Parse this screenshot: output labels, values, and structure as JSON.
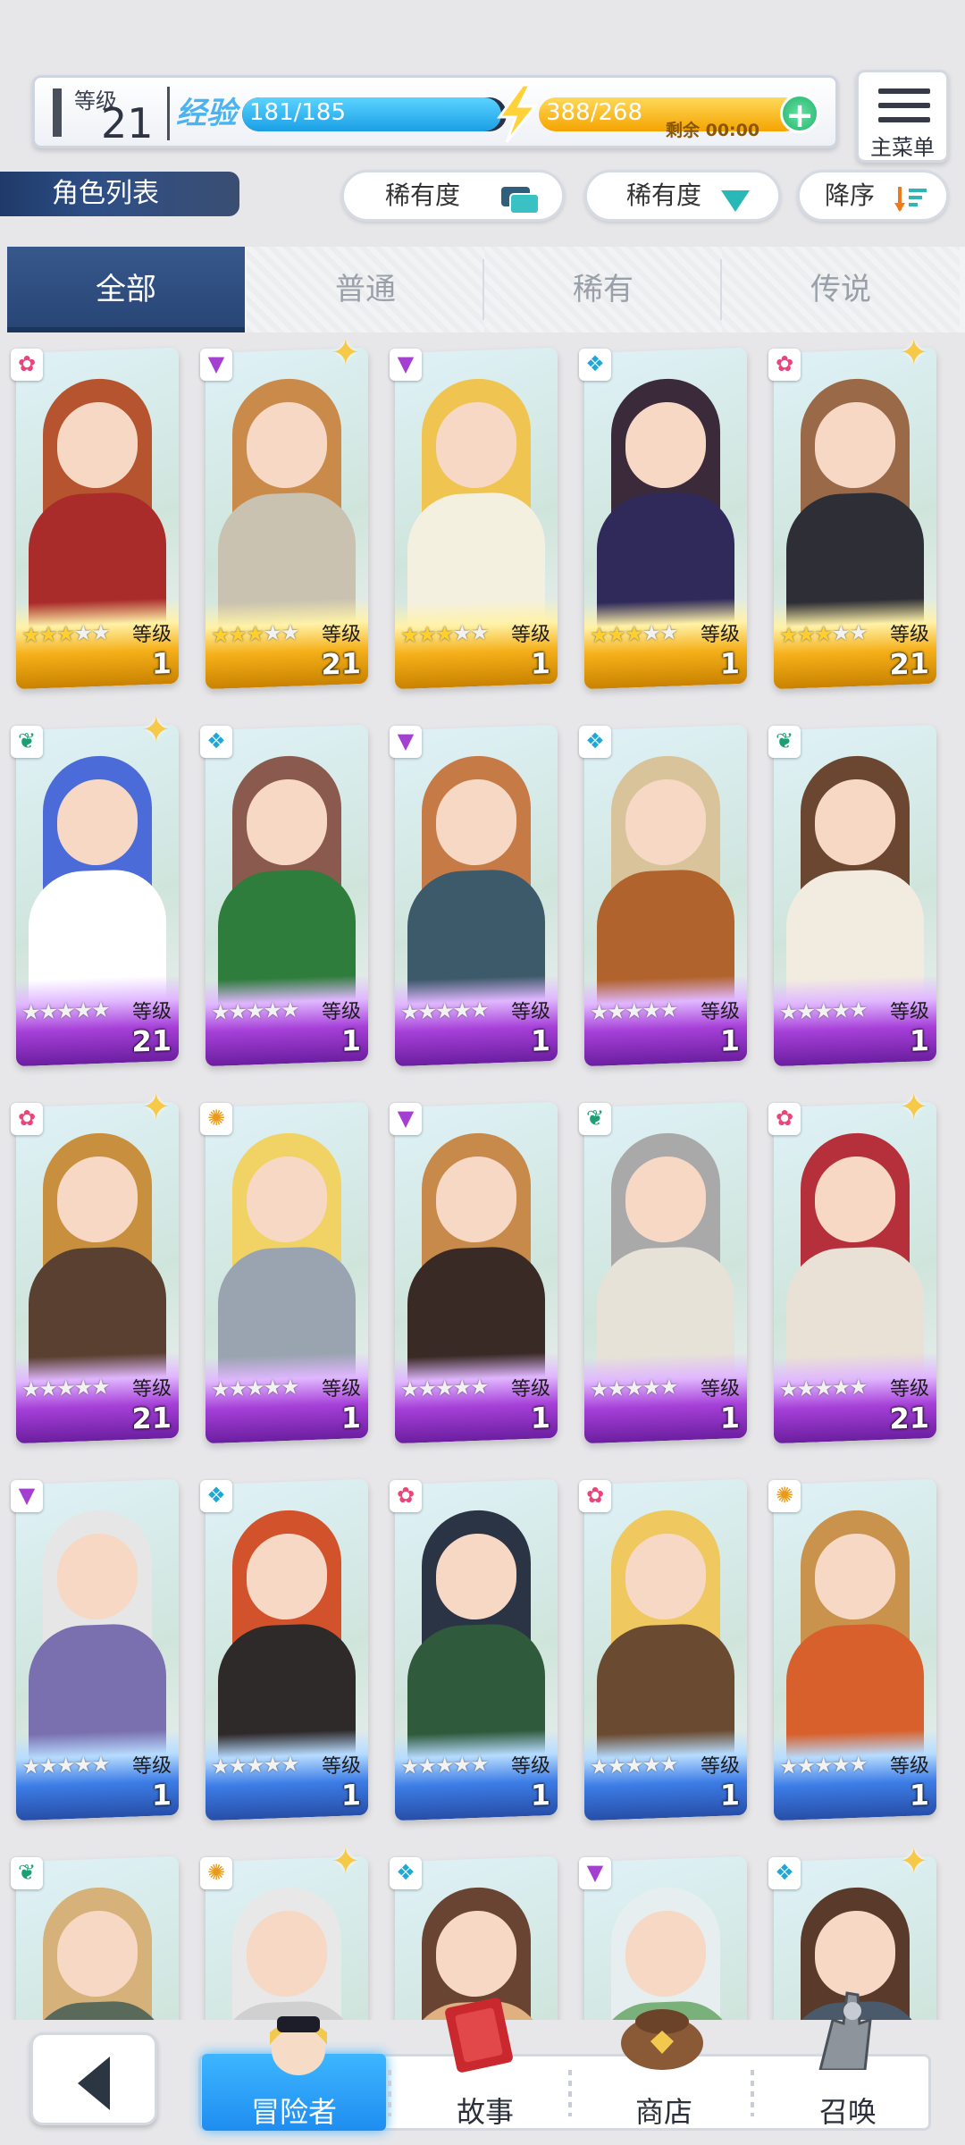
{
  "status": {
    "level_label": "等级",
    "level_value": "21",
    "exp_label": "经验",
    "exp_text": "181/185",
    "exp_fraction": 0.98,
    "energy_text": "388/268",
    "energy_fraction": 1.0,
    "energy_remaining": "剩余 00:00",
    "plus_symbol": "+",
    "menu_label": "主菜单"
  },
  "list_title": "角色列表",
  "sorters": [
    {
      "label": "稀有度",
      "icon": "layers-icon"
    },
    {
      "label": "稀有度",
      "icon": "triangle-down-icon"
    },
    {
      "label": "降序",
      "icon": "sort-descending-icon"
    }
  ],
  "tabs": [
    {
      "label": "全部",
      "active": true
    },
    {
      "label": "普通",
      "active": false
    },
    {
      "label": "稀有",
      "active": false
    },
    {
      "label": "传说",
      "active": false
    }
  ],
  "card_level_label": "等级",
  "cards": [
    {
      "element": "flower",
      "stars": 3,
      "level": "1",
      "rarity": "gold",
      "sparkle": false,
      "hair": "#b5542e",
      "outfit": "#a92c2a"
    },
    {
      "element": "triangle",
      "stars": 3,
      "level": "21",
      "rarity": "gold",
      "sparkle": true,
      "hair": "#c98a4a",
      "outfit": "#c9c2b0"
    },
    {
      "element": "triangle",
      "stars": 3,
      "level": "1",
      "rarity": "gold",
      "sparkle": false,
      "hair": "#f0c451",
      "outfit": "#f4f0e0"
    },
    {
      "element": "diamond",
      "stars": 3,
      "level": "1",
      "rarity": "gold",
      "sparkle": false,
      "hair": "#3b2b3a",
      "outfit": "#2f2a5a"
    },
    {
      "element": "flower",
      "stars": 3,
      "level": "21",
      "rarity": "gold",
      "sparkle": true,
      "hair": "#9a6a48",
      "outfit": "#2e2e36"
    },
    {
      "element": "leaf",
      "stars": 0,
      "level": "21",
      "rarity": "purple",
      "sparkle": true,
      "hair": "#4a6bd8",
      "outfit": "#ffffff"
    },
    {
      "element": "diamond",
      "stars": 0,
      "level": "1",
      "rarity": "purple",
      "sparkle": false,
      "hair": "#8a5a4e",
      "outfit": "#2f7d3c"
    },
    {
      "element": "triangle",
      "stars": 0,
      "level": "1",
      "rarity": "purple",
      "sparkle": false,
      "hair": "#c67a46",
      "outfit": "#3d5a6a"
    },
    {
      "element": "diamond",
      "stars": 0,
      "level": "1",
      "rarity": "purple",
      "sparkle": false,
      "hair": "#d9c39a",
      "outfit": "#b0632c"
    },
    {
      "element": "leaf",
      "stars": 0,
      "level": "1",
      "rarity": "purple",
      "sparkle": false,
      "hair": "#6b4630",
      "outfit": "#f2ece0"
    },
    {
      "element": "flower",
      "stars": 0,
      "level": "21",
      "rarity": "purple",
      "sparkle": true,
      "hair": "#c8903e",
      "outfit": "#5a4030"
    },
    {
      "element": "sun",
      "stars": 0,
      "level": "1",
      "rarity": "purple",
      "sparkle": false,
      "hair": "#f1d264",
      "outfit": "#9aa4b0"
    },
    {
      "element": "triangle",
      "stars": 0,
      "level": "1",
      "rarity": "purple",
      "sparkle": false,
      "hair": "#c88a4a",
      "outfit": "#3a2a26"
    },
    {
      "element": "leaf",
      "stars": 0,
      "level": "1",
      "rarity": "purple",
      "sparkle": false,
      "hair": "#a9a9a9",
      "outfit": "#e6e2d8"
    },
    {
      "element": "flower",
      "stars": 0,
      "level": "21",
      "rarity": "purple",
      "sparkle": true,
      "hair": "#b5303a",
      "outfit": "#e9e1d6"
    },
    {
      "element": "triangle",
      "stars": 0,
      "level": "1",
      "rarity": "blue",
      "sparkle": false,
      "hair": "#e6e6e6",
      "outfit": "#7a70b0"
    },
    {
      "element": "diamond",
      "stars": 0,
      "level": "1",
      "rarity": "blue",
      "sparkle": false,
      "hair": "#d2522c",
      "outfit": "#2e2a2a"
    },
    {
      "element": "flower",
      "stars": 0,
      "level": "1",
      "rarity": "blue",
      "sparkle": false,
      "hair": "#2b3444",
      "outfit": "#2f5a3c"
    },
    {
      "element": "flower",
      "stars": 0,
      "level": "1",
      "rarity": "blue",
      "sparkle": false,
      "hair": "#f0c860",
      "outfit": "#6a4a30"
    },
    {
      "element": "sun",
      "stars": 0,
      "level": "1",
      "rarity": "blue",
      "sparkle": false,
      "hair": "#c9934e",
      "outfit": "#d8602c"
    },
    {
      "element": "leaf",
      "stars": 0,
      "level": "",
      "rarity": "blue",
      "sparkle": false,
      "hair": "#d6b27a",
      "outfit": "#5a6a5a"
    },
    {
      "element": "sun",
      "stars": 0,
      "level": "",
      "rarity": "blue",
      "sparkle": true,
      "hair": "#e8e8e8",
      "outfit": "#d0d0d0"
    },
    {
      "element": "diamond",
      "stars": 0,
      "level": "",
      "rarity": "blue",
      "sparkle": false,
      "hair": "#6a4432",
      "outfit": "#e0b080"
    },
    {
      "element": "triangle",
      "stars": 0,
      "level": "",
      "rarity": "blue",
      "sparkle": false,
      "hair": "#e6eef0",
      "outfit": "#7ab07a"
    },
    {
      "element": "diamond",
      "stars": 0,
      "level": "",
      "rarity": "blue",
      "sparkle": true,
      "hair": "#5a3a2a",
      "outfit": "#4a5a6a"
    }
  ],
  "nav": [
    {
      "label": "冒险者",
      "active": true,
      "icon": "adventurer-icon"
    },
    {
      "label": "故事",
      "active": false,
      "icon": "book-icon"
    },
    {
      "label": "商店",
      "active": false,
      "icon": "bag-icon"
    },
    {
      "label": "召唤",
      "active": false,
      "icon": "summon-hand-icon"
    }
  ],
  "colors": {
    "gold": "#f5b01a",
    "purple": "#a640d8",
    "blue": "#3d7de6",
    "tab_active": "#2f4d7e",
    "nav_active": "#2ea3ff"
  }
}
